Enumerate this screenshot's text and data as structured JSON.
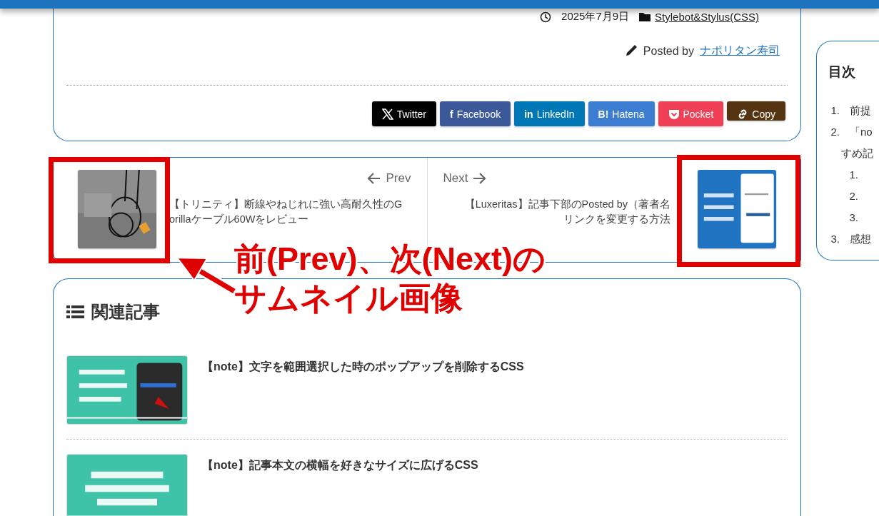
{
  "post_meta": {
    "date": "2025年7月9日",
    "category": "Stylebot&Stylus(CSS)",
    "posted_by_label": "Posted by",
    "author": "ナポリタン寿司"
  },
  "share_buttons": [
    {
      "kind": "x",
      "label": "Twitter",
      "color": "#000000"
    },
    {
      "kind": "facebook",
      "glyph": "f",
      "label": "Facebook",
      "color": "#3b5998"
    },
    {
      "kind": "linkedin",
      "glyph": "in",
      "label": "LinkedIn",
      "color": "#0077b5"
    },
    {
      "kind": "hatena",
      "glyph": "B!",
      "label": "Hatena",
      "color": "#3c7dd1"
    },
    {
      "kind": "pocket",
      "label": "Pocket",
      "color": "#ef4056"
    },
    {
      "kind": "copy",
      "label": "Copy",
      "color": "#543411"
    }
  ],
  "post_nav": {
    "prev": {
      "label": "Prev",
      "title_lines": [
        "【トリニティ】断線やねじれに強い高耐久性のG",
        "orillaケーブル60Wをレビュー"
      ],
      "thumbnail": {
        "kind": "picture"
      }
    },
    "next": {
      "label": "Next",
      "title_lines": [
        "【Luxeritas】記事下部のPosted by（著者名",
        "リンクを変更する方法"
      ],
      "thumbnail": {
        "kind": "picture"
      }
    }
  },
  "related": {
    "title": "関連記事",
    "items": [
      {
        "title": "【note】文字を範囲選択した時のポップアップを削除するCSS",
        "thumbnail": {
          "kind": "picture"
        }
      },
      {
        "title": "【note】記事本文の横幅を好きなサイズに広げるCSS",
        "thumbnail": {
          "kind": "picture"
        }
      }
    ]
  },
  "toc": {
    "title": "目次",
    "items": [
      {
        "number": "1.",
        "text": "前提"
      },
      {
        "number": "2.",
        "text": "「no",
        "continuation": "すめ記",
        "children": [
          {
            "number": "1."
          },
          {
            "number": "2."
          },
          {
            "number": "3."
          }
        ]
      },
      {
        "number": "3.",
        "text": "感想"
      }
    ]
  },
  "annotation": {
    "lines": [
      "前(Prev)、次(Next)の",
      "サムネイル画像"
    ]
  }
}
